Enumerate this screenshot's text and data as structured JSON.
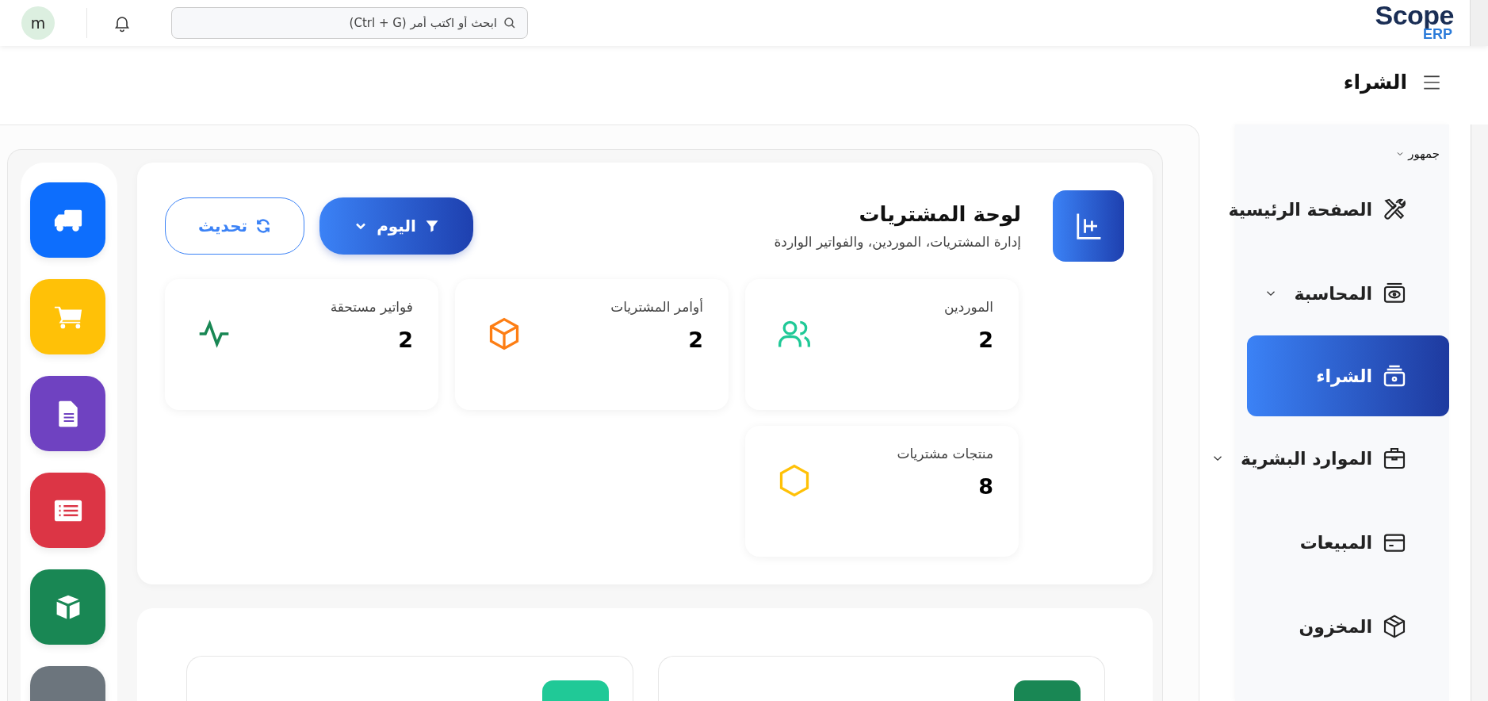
{
  "topbar": {
    "avatar": "m",
    "search": {
      "placeholder": "ابحث أو اكتب أمر (Ctrl + G)"
    },
    "logo": {
      "name": "Scope",
      "suffix": "ERP"
    }
  },
  "page_title": "الشراء",
  "sidebar": {
    "group": "جمهور",
    "items": [
      {
        "label": "الصفحة الرئيسية",
        "kind": "tools",
        "expandable": false,
        "selected": false
      },
      {
        "label": "المحاسبة",
        "kind": "money",
        "expandable": true,
        "selected": false
      },
      {
        "label": "الشراء",
        "kind": "purchase",
        "expandable": false,
        "selected": true
      },
      {
        "label": "الموارد البشرية",
        "kind": "toolbox",
        "expandable": true,
        "selected": false
      },
      {
        "label": "المبيعات",
        "kind": "card",
        "expandable": false,
        "selected": false
      },
      {
        "label": "المخزون",
        "kind": "box",
        "expandable": false,
        "selected": false
      }
    ]
  },
  "shortcuts": [
    {
      "kind": "truck",
      "color": "#0d6efd"
    },
    {
      "kind": "cart",
      "color": "#ffc107"
    },
    {
      "kind": "document",
      "color": "#6f42c1"
    },
    {
      "kind": "list",
      "color": "#dc3545"
    },
    {
      "kind": "cube",
      "color": "#198754"
    },
    {
      "kind": "partial",
      "color": "#6c757d"
    }
  ],
  "dashboard": {
    "title": "لوحة المشتريات",
    "subtitle": "إدارة المشتريات، الموردين، والفواتير الواردة",
    "filter_button": "اليوم",
    "refresh_button": "تحديث",
    "stats": [
      {
        "label": "الموردين",
        "value": "2",
        "kind": "users",
        "color": "#20c997"
      },
      {
        "label": "أوامر المشتريات",
        "value": "2",
        "kind": "cube",
        "color": "#fd7e14"
      },
      {
        "label": "فواتير مستحقة",
        "value": "2",
        "kind": "pulse",
        "color": "#198754"
      },
      {
        "label": "منتجات مشتريات",
        "value": "8",
        "kind": "hexagon",
        "color": "#ffc107"
      }
    ]
  },
  "lower_panels": [
    {
      "color": "#198754"
    },
    {
      "color": "#20c997"
    }
  ]
}
